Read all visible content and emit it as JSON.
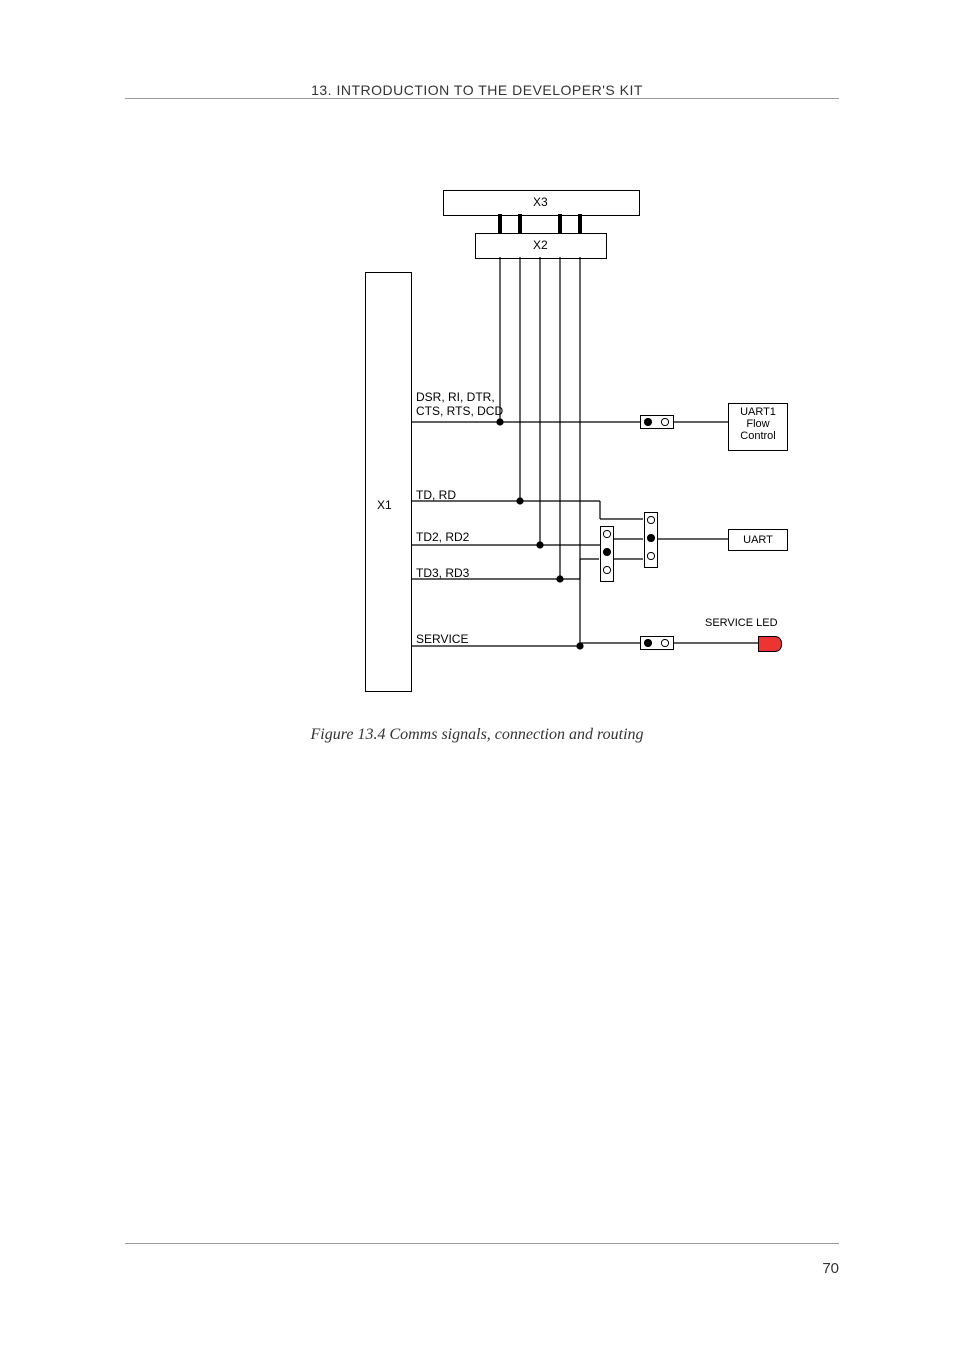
{
  "header": "13. INTRODUCTION TO THE DEVELOPER'S KIT",
  "page_number": "70",
  "caption": "Figure 13.4  Comms signals, connection and routing",
  "diagram": {
    "blocks": {
      "x1": "X1",
      "x2": "X2",
      "x3": "X3"
    },
    "signals": {
      "dsr_group": "DSR, RI, DTR,\nCTS, RTS, DCD",
      "td_rd": "TD, RD",
      "td2_rd2": "TD2, RD2",
      "td3_rd3": "TD3, RD3",
      "service": "SERVICE"
    },
    "right_labels": {
      "uart1_flow": "UART1\nFlow\nControl",
      "uart": "UART",
      "service_led": "SERVICE LED"
    }
  }
}
